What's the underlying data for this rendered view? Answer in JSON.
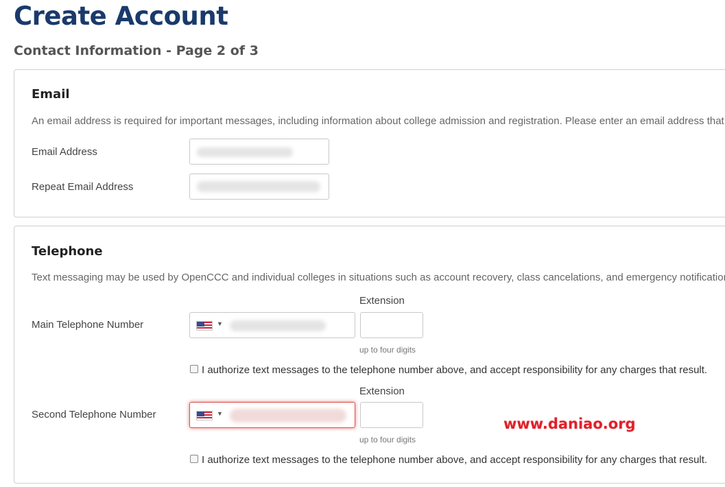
{
  "header": {
    "title": "Create Account",
    "subtitle": "Contact Information - Page 2 of 3"
  },
  "email_section": {
    "heading": "Email",
    "description": "An email address is required for important messages, including information about college admission and registration. Please enter an email address that yo",
    "email_label": "Email Address",
    "repeat_label": "Repeat Email Address"
  },
  "telephone_section": {
    "heading": "Telephone",
    "description": "Text messaging may be used by OpenCCC and individual colleges in situations such as account recovery, class cancelations, and emergency notifications. If",
    "main": {
      "label": "Main Telephone Number",
      "extension_label": "Extension",
      "extension_hint": "up to four digits",
      "authorize_text": "I authorize text messages to the telephone number above, and accept responsibility for any charges that result."
    },
    "second": {
      "label": "Second Telephone Number",
      "extension_label": "Extension",
      "extension_hint": "up to four digits",
      "authorize_text": "I authorize text messages to the telephone number above, and accept responsibility for any charges that result.",
      "state": "error"
    },
    "country_icon": "us-flag-icon"
  },
  "watermark": "www.daniao.org",
  "colors": {
    "title": "#1a3a6b",
    "error_border": "#d9534f",
    "watermark": "#e0202a"
  }
}
